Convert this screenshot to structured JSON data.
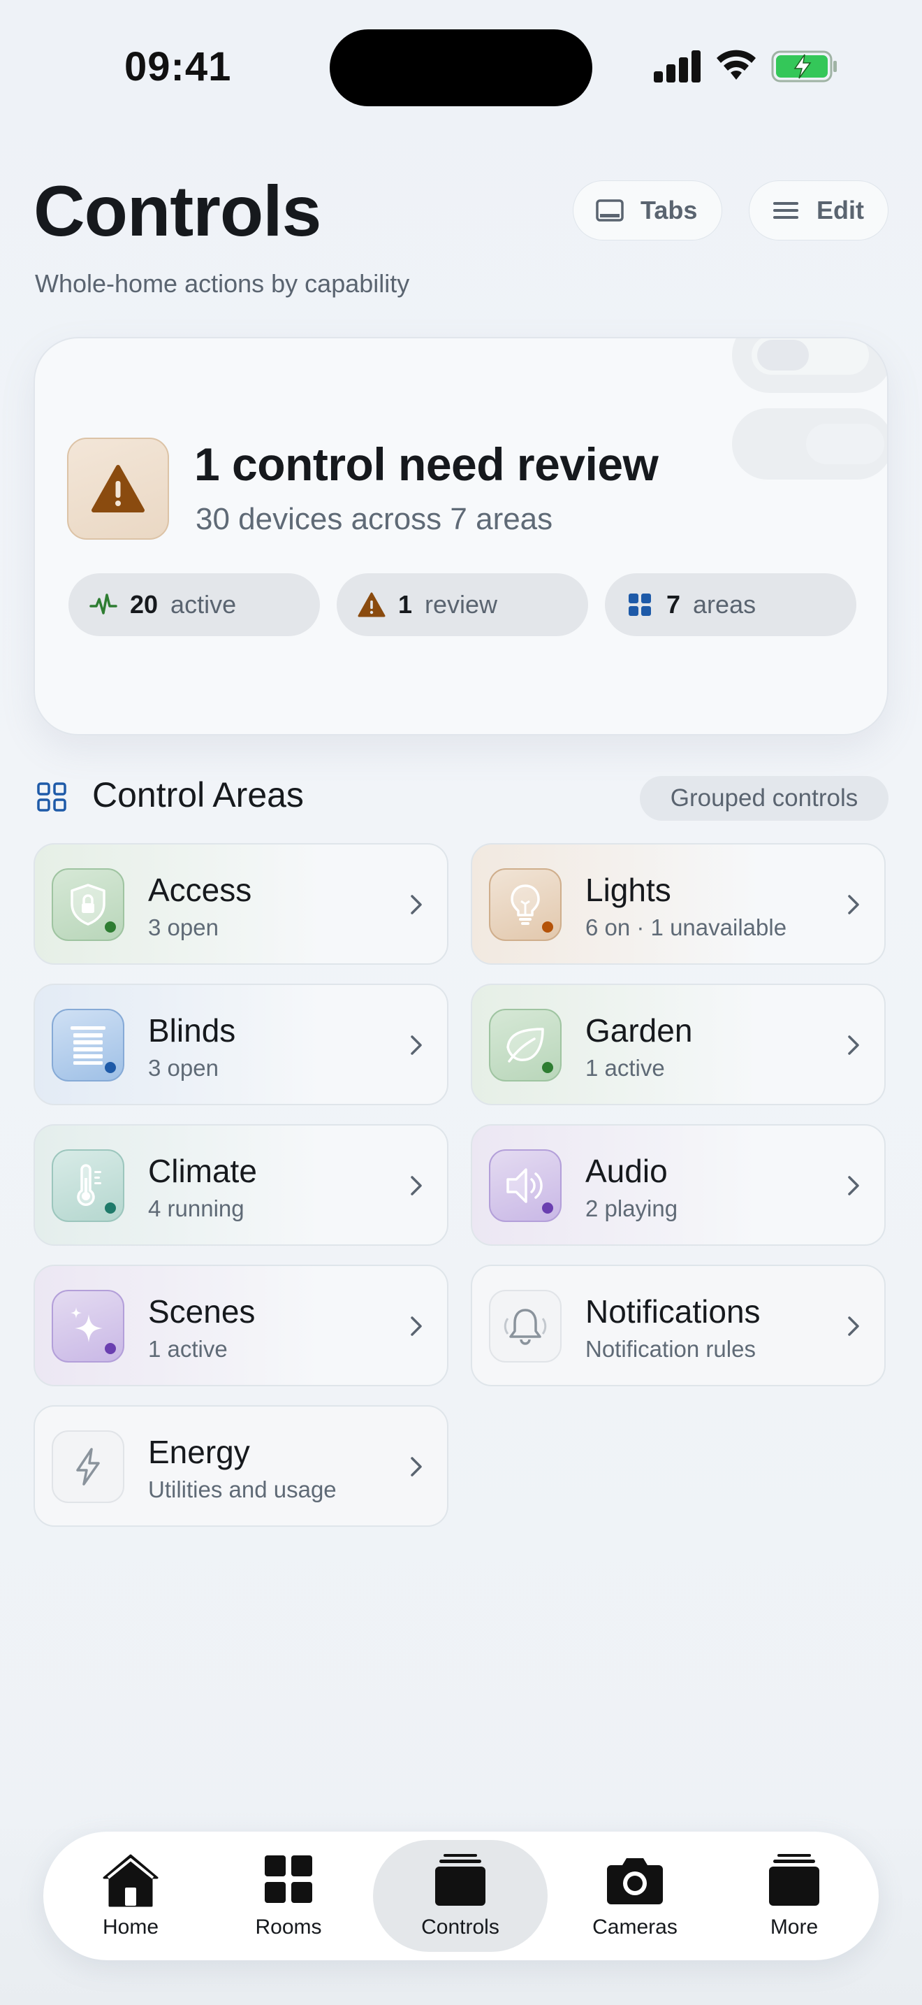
{
  "status_bar": {
    "time": "09:41"
  },
  "header": {
    "title": "Controls",
    "subtitle": "Whole-home actions by capability",
    "tabs_label": "Tabs",
    "edit_label": "Edit"
  },
  "summary": {
    "title": "1 control need review",
    "subtitle": "30 devices across 7 areas",
    "stats": [
      {
        "value": "20",
        "label": "active",
        "icon": "activity-icon"
      },
      {
        "value": "1",
        "label": "review",
        "icon": "warning-icon"
      },
      {
        "value": "7",
        "label": "areas",
        "icon": "grid-icon"
      }
    ]
  },
  "section": {
    "title": "Control Areas",
    "badge": "Grouped controls"
  },
  "areas": [
    {
      "name": "Access",
      "status": "3 open",
      "icon": "shield-lock-icon",
      "tint": "#e6efe6",
      "dot": "#2e7d32"
    },
    {
      "name": "Lights",
      "status": "6 on · 1 unavailable",
      "icon": "lightbulb-icon",
      "tint": "#f2e9e0",
      "dot": "#b45309"
    },
    {
      "name": "Blinds",
      "status": "3 open",
      "icon": "blinds-icon",
      "tint": "#e3ebf5",
      "dot": "#1e5aa8"
    },
    {
      "name": "Garden",
      "status": "1 active",
      "icon": "leaf-icon",
      "tint": "#e6efe6",
      "dot": "#2e7d32"
    },
    {
      "name": "Climate",
      "status": "4 running",
      "icon": "thermometer-icon",
      "tint": "#e4eeec",
      "dot": "#1f7a6a"
    },
    {
      "name": "Audio",
      "status": "2 playing",
      "icon": "speaker-icon",
      "tint": "#ece7f3",
      "dot": "#6a3fb0"
    },
    {
      "name": "Scenes",
      "status": "1 active",
      "icon": "sparkle-icon",
      "tint": "#ece7f3",
      "dot": "#6a3fb0"
    },
    {
      "name": "Notifications",
      "status": "Notification rules",
      "icon": "bell-icon",
      "tint": "#f1f3f5",
      "dot": ""
    },
    {
      "name": "Energy",
      "status": "Utilities and usage",
      "icon": "bolt-icon",
      "tint": "#f1f3f5",
      "dot": ""
    }
  ],
  "tab_bar": {
    "items": [
      {
        "label": "Home",
        "icon": "home-icon"
      },
      {
        "label": "Rooms",
        "icon": "rooms-grid-icon"
      },
      {
        "label": "Controls",
        "icon": "controls-stack-icon",
        "active": true
      },
      {
        "label": "Cameras",
        "icon": "camera-icon"
      },
      {
        "label": "More",
        "icon": "more-stack-icon"
      }
    ]
  },
  "colors": {
    "warning_brown": "#8a4b0f",
    "active_green": "#2e7d32",
    "areas_blue": "#1e5aa8",
    "text_primary": "#16191d",
    "text_secondary": "#5a6470"
  }
}
